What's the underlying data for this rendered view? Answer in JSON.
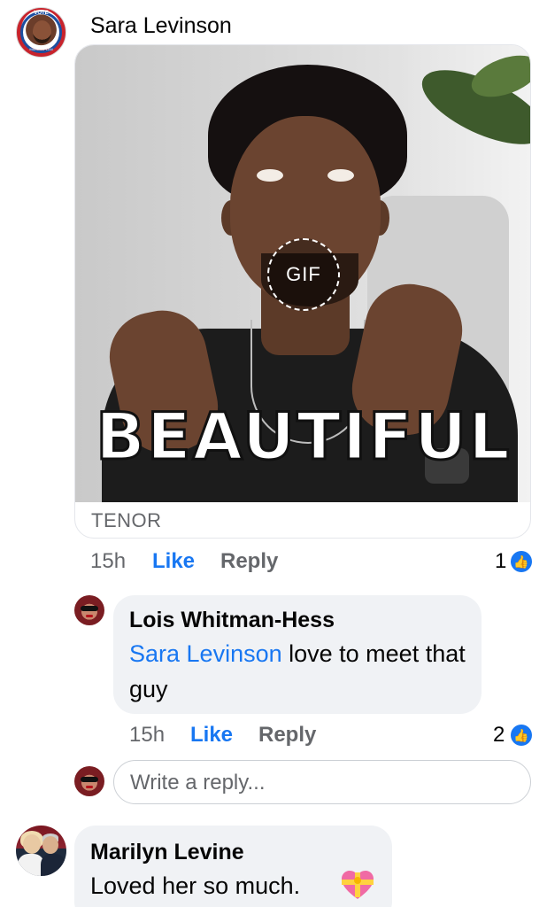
{
  "comments": [
    {
      "author": "Sara Levinson",
      "avatar": "sara-avatar",
      "attachment": {
        "type": "gif",
        "badge": "GIF",
        "caption": "BEAUTIFUL",
        "source": "TENOR"
      },
      "time": "15h",
      "like_label": "Like",
      "reply_label": "Reply",
      "reaction_count": "1",
      "reaction_icon": "thumbs-up-icon",
      "replies": [
        {
          "author": "Lois Whitman-Hess",
          "mention": "Sara Levinson",
          "text": " love to meet that guy",
          "time": "15h",
          "like_label": "Like",
          "reply_label": "Reply",
          "reaction_count": "2",
          "reaction_icon": "thumbs-up-icon"
        }
      ],
      "reply_input": {
        "placeholder": "Write a reply..."
      }
    },
    {
      "author": "Marilyn Levine",
      "text": "Loved her so much.",
      "emoji": "heart-with-ribbon-icon"
    }
  ],
  "colors": {
    "link_blue": "#1877f2",
    "meta_gray": "#65676b",
    "bubble_bg": "#f0f2f5"
  }
}
